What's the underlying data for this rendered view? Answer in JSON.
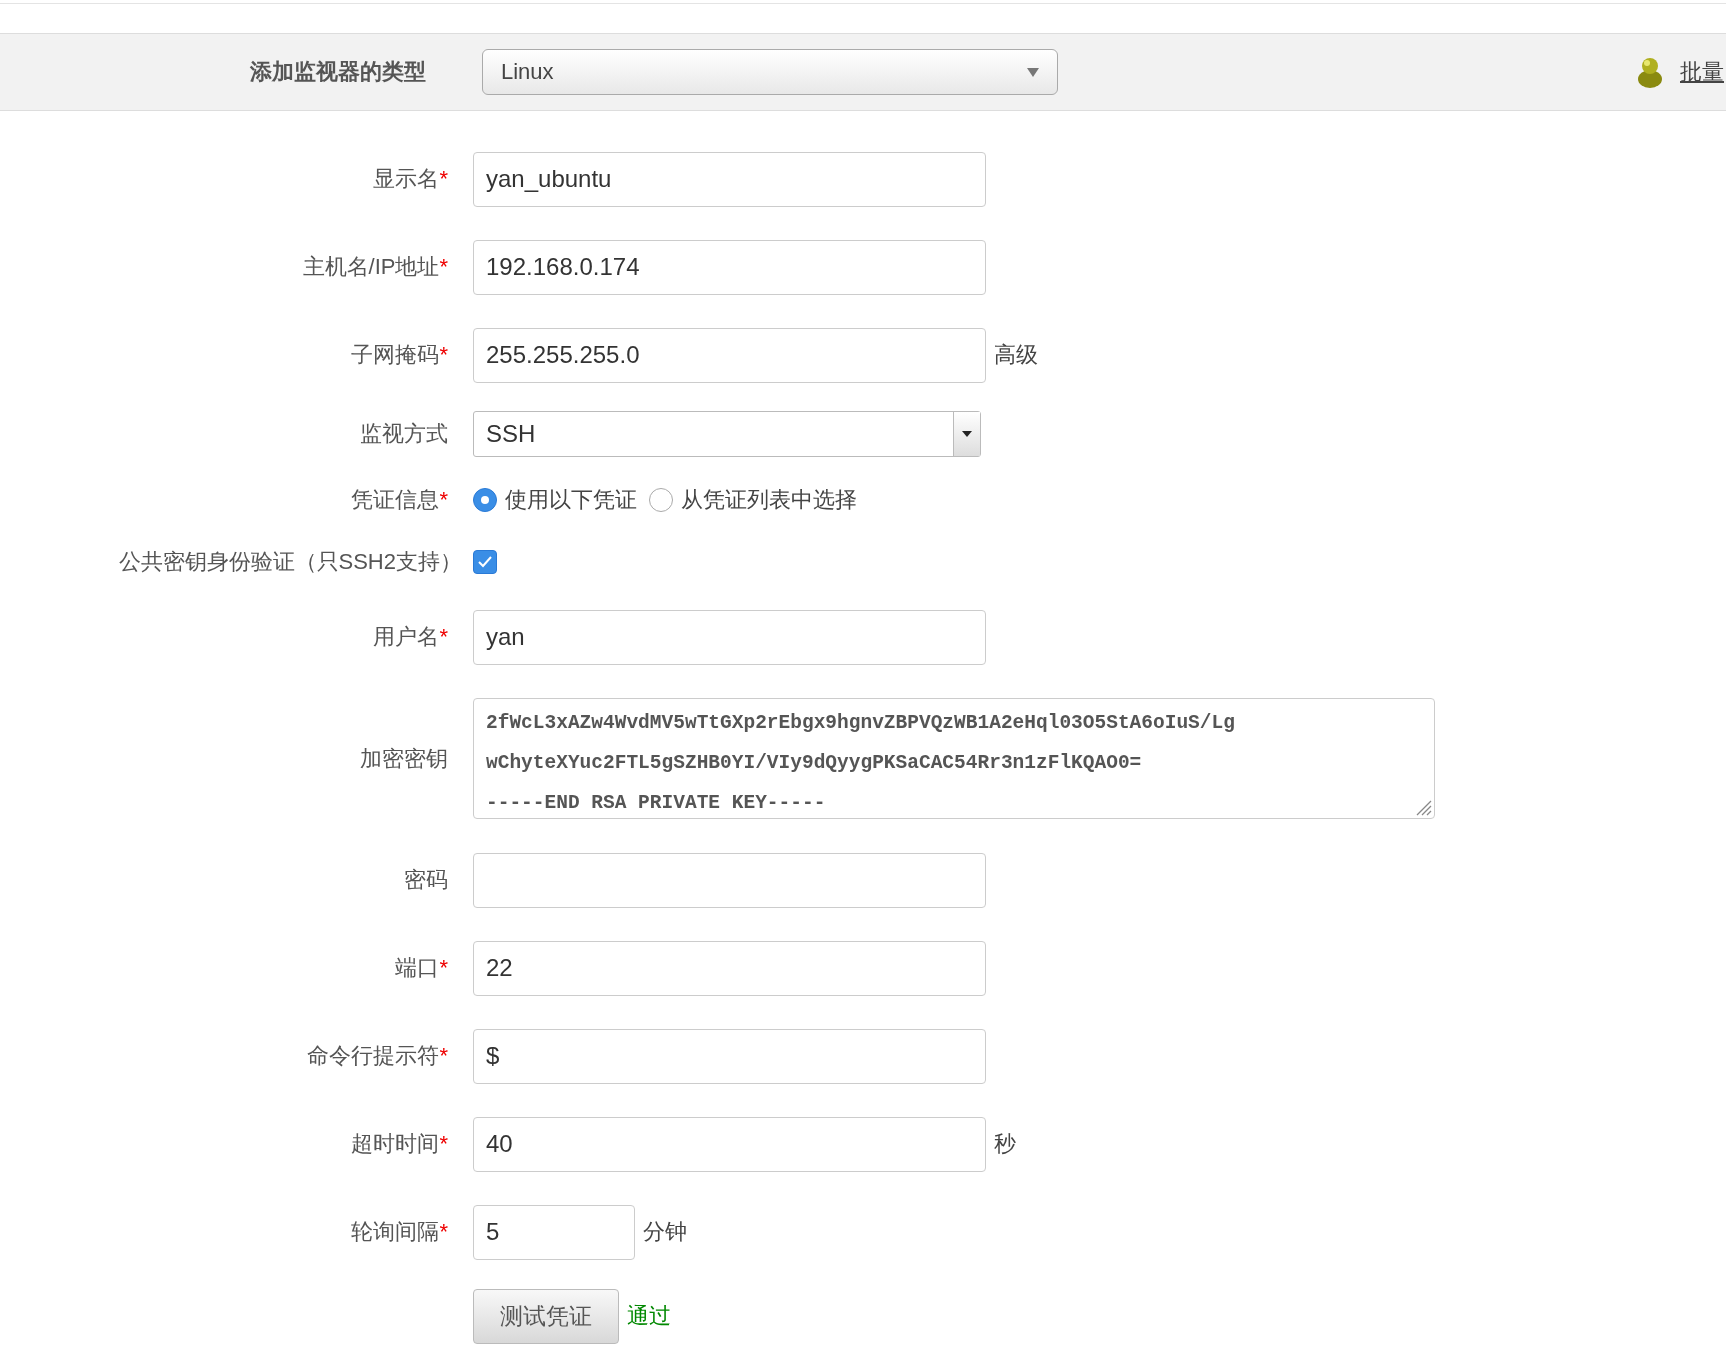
{
  "toolbar": {
    "label": "添加监视器的类型",
    "type_select": {
      "value": "Linux"
    },
    "bulk_link": "批量"
  },
  "form": [
    {
      "kind": "text",
      "label": "显示名",
      "required_mark": "*",
      "value": "yan_ubuntu"
    },
    {
      "kind": "text",
      "label": "主机名/IP地址",
      "required_mark": "*",
      "value": "192.168.0.174"
    },
    {
      "kind": "text",
      "label": "子网掩码",
      "required_mark": "*",
      "value": "255.255.255.0",
      "suffix": "高级"
    },
    {
      "kind": "select",
      "label": "监视方式",
      "value": "SSH"
    },
    {
      "kind": "radio",
      "label": "凭证信息",
      "required_mark": "*",
      "options": [
        {
          "label": "使用以下凭证",
          "selected": true
        },
        {
          "label": "从凭证列表中选择",
          "selected": false
        }
      ]
    },
    {
      "kind": "checkbox",
      "label": "公共密钥身份验证（只SSH2支持）",
      "checked": true
    },
    {
      "kind": "text",
      "label": "用户名",
      "required_mark": "*",
      "value": "yan"
    },
    {
      "kind": "textarea",
      "label": "加密密钥",
      "lines": [
        "2fWcL3xAZw4WvdMV5wTtGXp2rEbgx9hgnvZBPVQzWB1A2eHql03O5StA6oIuS/Lg",
        "wChyteXYuc2FTL5gSZHB0YI/VIy9dQyygPKSaCAC54Rr3n1zFlKQAO0=",
        "-----END RSA PRIVATE KEY-----"
      ]
    },
    {
      "kind": "text",
      "label": "密码"
    },
    {
      "kind": "text",
      "label": "端口",
      "required_mark": "*",
      "value": "22"
    },
    {
      "kind": "text",
      "label": "命令行提示符",
      "required_mark": "*",
      "value": "$"
    },
    {
      "kind": "text",
      "label": "超时时间",
      "required_mark": "*",
      "value": "40",
      "suffix": "秒"
    },
    {
      "kind": "short",
      "label": "轮询间隔",
      "required_mark": "*",
      "value": "5",
      "suffix": "分钟"
    },
    {
      "kind": "button",
      "label": "测试凭证",
      "result": "通过"
    }
  ]
}
